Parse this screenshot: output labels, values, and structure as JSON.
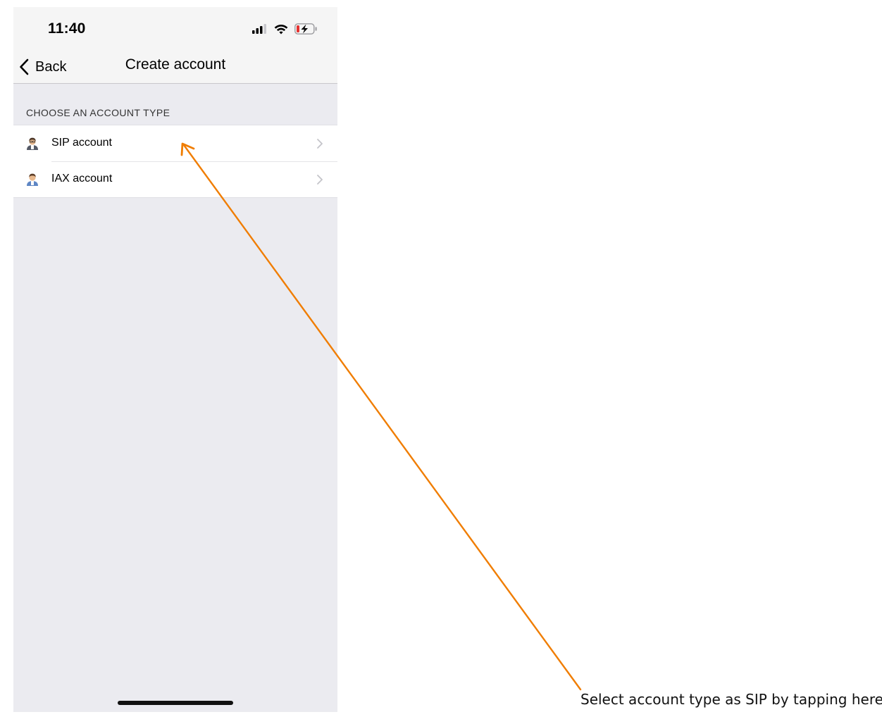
{
  "status_bar": {
    "time": "11:40",
    "icons": [
      "signal-icon",
      "wifi-icon",
      "battery-charging-icon"
    ]
  },
  "navbar": {
    "back_label": "Back",
    "title": "Create account"
  },
  "section": {
    "header": "CHOOSE AN ACCOUNT TYPE",
    "items": [
      {
        "label": "SIP account",
        "icon": "user-avatar-icon"
      },
      {
        "label": "IAX account",
        "icon": "user-avatar-icon"
      }
    ]
  },
  "annotation": {
    "text": "Select account type as SIP by tapping here",
    "color": "#f07d00"
  },
  "colors": {
    "background": "#ebebf0",
    "bar": "#f5f5f5",
    "battery_low": "#e5312f"
  }
}
